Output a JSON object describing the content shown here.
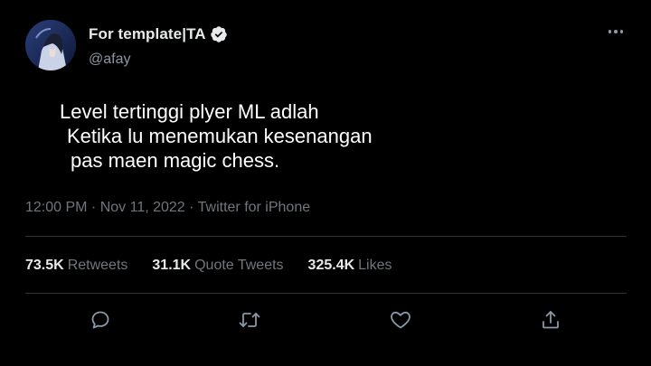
{
  "author": {
    "display_name": "For template|TA",
    "handle": "@afay",
    "verified": true,
    "avatar": "anime-character-avatar"
  },
  "menu": {
    "more_icon": "more-horizontal-icon"
  },
  "tweet": {
    "lines": [
      "Level tertinggi plyer ML adlah",
      "Ketika lu menemukan kesenangan",
      "pas maen magic chess."
    ]
  },
  "meta": {
    "time": "12:00 PM",
    "date": "Nov 11, 2022",
    "source": "Twitter for iPhone",
    "text": "12:00 PM · Nov 11, 2022 · Twitter for iPhone"
  },
  "stats": {
    "retweets": {
      "count": "73.5K",
      "label": "Retweets"
    },
    "quotes": {
      "count": "31.1K",
      "label": "Quote Tweets"
    },
    "likes": {
      "count": "325.4K",
      "label": "Likes"
    }
  },
  "actions": [
    "reply-icon",
    "retweet-icon",
    "like-icon",
    "share-icon"
  ],
  "colors": {
    "background": "#000000",
    "primary_text": "#e7e9ea",
    "secondary_text": "#71767b",
    "divider": "#2f3336",
    "verified_badge": "#e7e9ea"
  }
}
